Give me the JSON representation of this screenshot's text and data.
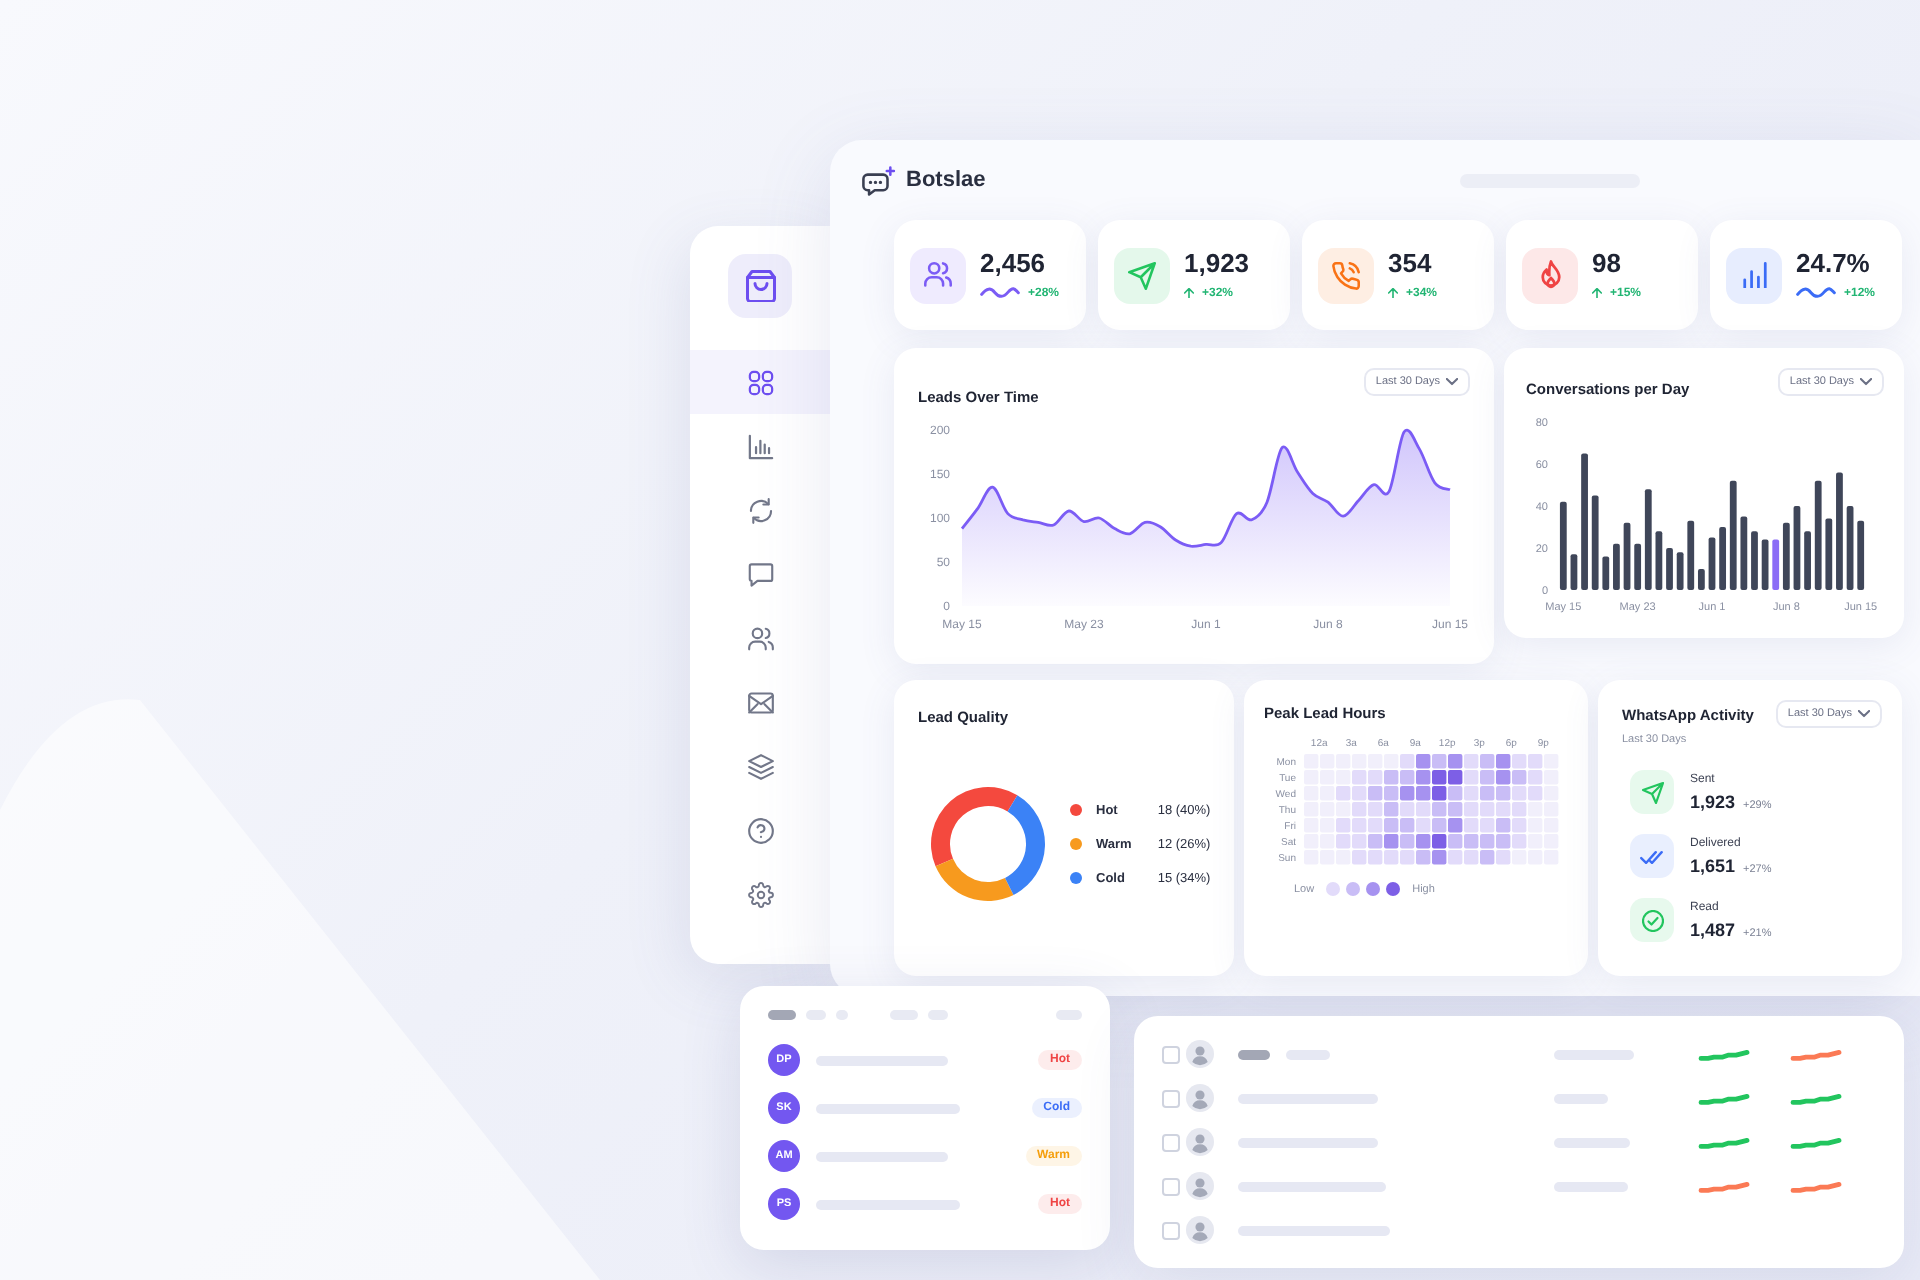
{
  "brand": {
    "name": "Botslae"
  },
  "sidebar": {
    "items": [
      {
        "selected": true
      },
      {
        "selected": false
      },
      {
        "selected": false
      },
      {
        "selected": false
      },
      {
        "selected": false
      },
      {
        "selected": false
      },
      {
        "selected": false
      },
      {
        "selected": false
      },
      {
        "selected": false
      }
    ]
  },
  "stats": [
    {
      "value": "2,456",
      "change": "+28%",
      "kind": "wave",
      "color": "#7b5cf5"
    },
    {
      "value": "1,923",
      "change": "+32%",
      "kind": "arrow",
      "color": "#22c55e"
    },
    {
      "value": "354",
      "change": "+34%",
      "kind": "arrow",
      "color": "#f97316"
    },
    {
      "value": "98",
      "change": "+15%",
      "kind": "arrow",
      "color": "#ef4444"
    },
    {
      "value": "24.7%",
      "change": "+12%",
      "kind": "wave",
      "color": "#3b6cf6"
    }
  ],
  "leads_over_time": {
    "title": "Leads Over Time",
    "range": "Last 30 Days",
    "chart_data": {
      "type": "area",
      "categories": [
        "May 15",
        null,
        null,
        null,
        null,
        null,
        null,
        null,
        "May 23",
        null,
        null,
        null,
        null,
        null,
        null,
        null,
        "Jun 1",
        null,
        null,
        null,
        null,
        null,
        null,
        null,
        "Jun 8",
        null,
        null,
        null,
        null,
        null,
        null,
        null,
        "Jun 15"
      ],
      "series": [
        {
          "color": "#7b5cf5",
          "values": [
            88,
            110,
            135,
            105,
            98,
            95,
            92,
            108,
            96,
            100,
            88,
            82,
            95,
            90,
            75,
            68,
            70,
            72,
            105,
            98,
            118,
            180,
            152,
            128,
            118,
            102,
            120,
            138,
            130,
            198,
            178,
            140,
            132
          ]
        }
      ],
      "ylim": [
        0,
        200
      ],
      "yticks": [
        0,
        50,
        100,
        150,
        200
      ]
    }
  },
  "conversations_per_day": {
    "title": "Conversations per Day",
    "range": "Last 30 Days",
    "chart_data": {
      "type": "bar",
      "categories": [
        "May 15",
        null,
        null,
        null,
        null,
        null,
        null,
        "May 23",
        null,
        null,
        null,
        null,
        null,
        null,
        "Jun 1",
        null,
        null,
        null,
        null,
        null,
        null,
        "Jun 8",
        null,
        null,
        null,
        null,
        null,
        null,
        "Jun 15"
      ],
      "series": [
        {
          "color": "#3f4659",
          "values": [
            42,
            17,
            65,
            45,
            16,
            22,
            32,
            22,
            48,
            28,
            20,
            18,
            33,
            10,
            25,
            30,
            52,
            35,
            28,
            24,
            null,
            32,
            40,
            28,
            52,
            34,
            56,
            40,
            33
          ]
        },
        {
          "color": "#8b6cf6",
          "values": [
            null,
            null,
            null,
            null,
            null,
            null,
            null,
            null,
            null,
            null,
            null,
            null,
            null,
            null,
            null,
            null,
            null,
            null,
            null,
            null,
            24,
            null,
            null,
            null,
            null,
            null,
            null,
            null,
            null
          ]
        }
      ],
      "ylim": [
        0,
        80
      ],
      "yticks": [
        0,
        20,
        40,
        60,
        80
      ]
    }
  },
  "lead_quality": {
    "title": "Lead Quality",
    "legend": [
      {
        "reading": "18 (40%)",
        "color": "#f4493e"
      },
      {
        "reading": "12 (26%)",
        "color": "#f79a1e"
      },
      {
        "reading": "15 (34%)",
        "color": "#3b82f6"
      }
    ],
    "chart_data": {
      "type": "donut",
      "categories": [
        "Hot",
        "Warm",
        "Cold"
      ],
      "values": [
        40,
        26,
        34
      ]
    }
  },
  "peak_lead_hours": {
    "title": "Peak Lead Hours",
    "columns": [
      "12a",
      "3a",
      "6a",
      "9a",
      "12p",
      "3p",
      "6p",
      "9p"
    ],
    "rows": [
      "Mon",
      "Tue",
      "Wed",
      "Thu",
      "Fri",
      "Sat",
      "Sun"
    ],
    "legend": {
      "low": "Low",
      "high": "High"
    }
  },
  "whatsapp_activity": {
    "title": "WhatsApp Activity",
    "range": "Last 30 Days",
    "subtitle": "Last 30 Days",
    "items": [
      {
        "label": "Sent",
        "value": "1,923",
        "change": "+29%",
        "color": "#22c55e"
      },
      {
        "label": "Delivered",
        "value": "1,651",
        "change": "+27%",
        "color": "#3b6cf6"
      },
      {
        "label": "Read",
        "value": "1,487",
        "change": "+21%",
        "color": "#22c55e"
      }
    ]
  },
  "leads_card": {
    "rows": [
      {
        "initials": "DP",
        "tag": "Hot",
        "color": "#ef4444"
      },
      {
        "initials": "SK",
        "tag": "Cold",
        "color": "#3b6cf6"
      },
      {
        "initials": "AM",
        "tag": "Warm",
        "color": "#f59e0b"
      },
      {
        "initials": "PS",
        "tag": "Hot",
        "color": "#ef4444"
      }
    ]
  },
  "contacts_table": {
    "rows": [
      {
        "checked": false,
        "sparklines": [
          {
            "color": "#22c55e"
          },
          {
            "color": "#fb7a55"
          }
        ]
      },
      {
        "checked": false,
        "sparklines": [
          {
            "color": "#22c55e"
          },
          {
            "color": "#22c55e"
          }
        ]
      },
      {
        "checked": false,
        "sparklines": [
          {
            "color": "#22c55e"
          },
          {
            "color": "#22c55e"
          }
        ]
      },
      {
        "checked": false,
        "sparklines": [
          {
            "color": "#fb7a55"
          },
          {
            "color": "#fb7a55"
          }
        ]
      },
      {
        "checked": false
      }
    ]
  }
}
